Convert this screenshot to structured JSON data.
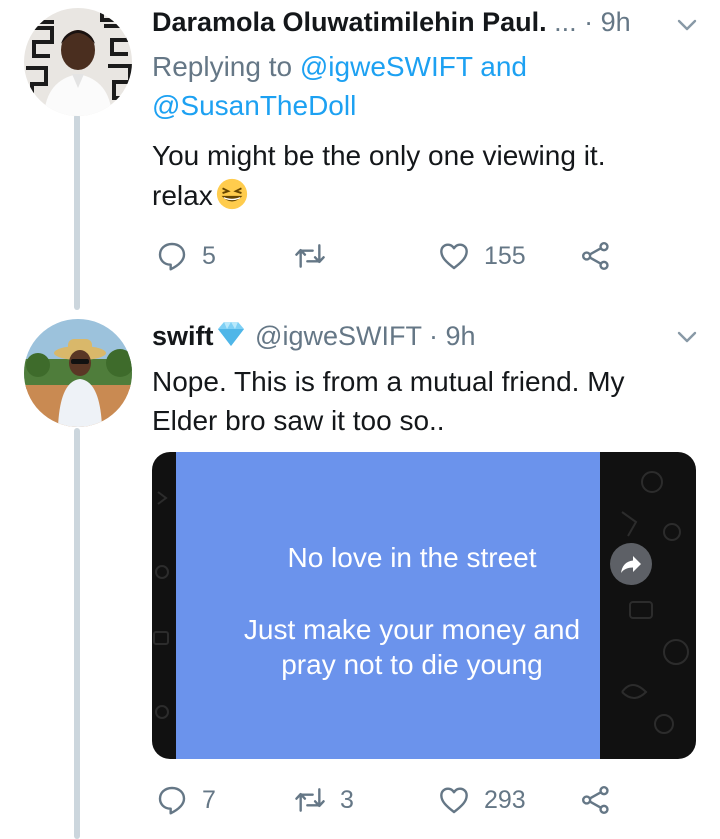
{
  "tweet1": {
    "name": "Daramola Oluwatimilehin Paul.",
    "ellipsis": "...",
    "time": "· 9h",
    "replying_prefix": "Replying to",
    "replying_handle1": "@igweSWIFT",
    "replying_and": "and",
    "replying_handle2": "@SusanTheDoll",
    "text_line1": "You might be the only one viewing it.",
    "text_line2": "relax",
    "emoji": "grinning-squinting-face",
    "replies": "5",
    "retweets": "",
    "likes": "155"
  },
  "tweet2": {
    "name": "swift",
    "badge": "diamond-emoji",
    "handle": "@igweSWIFT",
    "time": "· 9h",
    "text_line1": "Nope. This is from a mutual friend. My",
    "text_line2": "Elder bro saw it too so..",
    "media": {
      "line1": "No love in the street",
      "line2": "Just make your money and",
      "line3": "pray not to die young"
    },
    "replies": "7",
    "retweets": "3",
    "likes": "293"
  },
  "colors": {
    "text": "#14171a",
    "muted": "#657786",
    "link": "#1da1f2",
    "thread_line": "#ccd6dd",
    "media_panel": "#6b93ec"
  }
}
